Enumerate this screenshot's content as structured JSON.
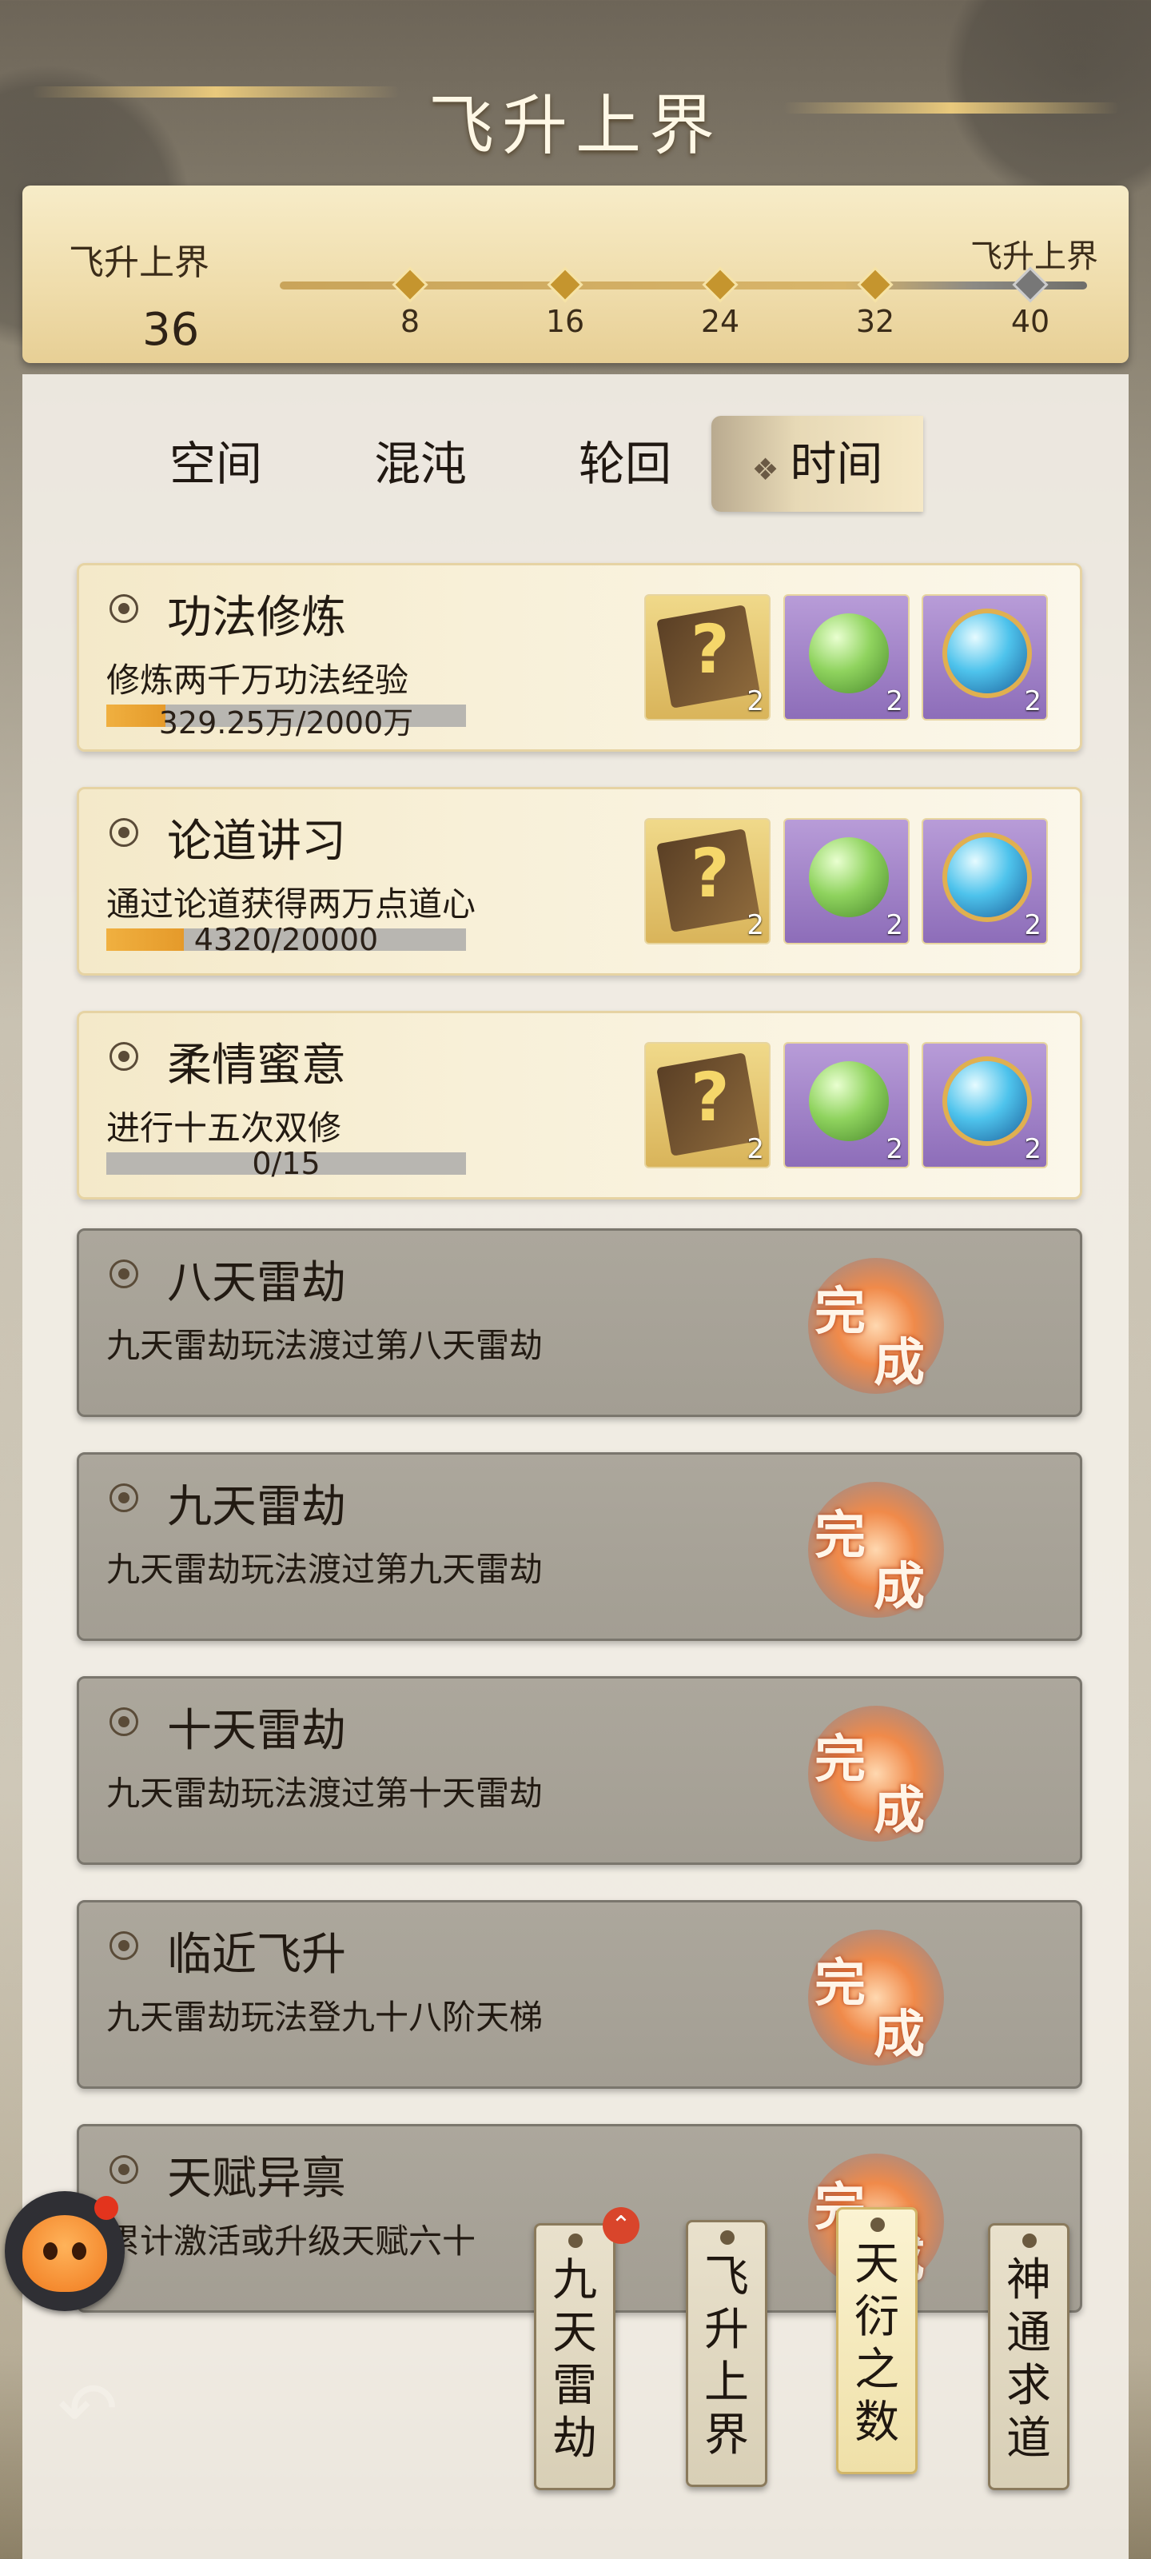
{
  "page": {
    "title": "飞升上界"
  },
  "progress": {
    "left_label": "飞升上界",
    "current": "36",
    "right_label": "飞升上界",
    "ticks": [
      "8",
      "16",
      "24",
      "32",
      "40"
    ]
  },
  "tabs": [
    {
      "label": "空间"
    },
    {
      "label": "混沌"
    },
    {
      "label": "轮回"
    },
    {
      "label": "时间"
    }
  ],
  "tasks": [
    {
      "name": "功法修炼",
      "desc": "修炼两千万功法经验",
      "progress_text": "329.25万/2000万",
      "progress": 0.1646,
      "rewards": [
        "2",
        "2",
        "2"
      ]
    },
    {
      "name": "论道讲习",
      "desc": "通过论道获得两万点道心",
      "progress_text": "4320/20000",
      "progress": 0.216,
      "rewards": [
        "2",
        "2",
        "2"
      ]
    },
    {
      "name": "柔情蜜意",
      "desc": "进行十五次双修",
      "progress_text": "0/15",
      "progress": 0,
      "rewards": [
        "2",
        "2",
        "2"
      ]
    },
    {
      "name": "八天雷劫",
      "desc": "九天雷劫玩法渡过第八天雷劫",
      "status": "完成"
    },
    {
      "name": "九天雷劫",
      "desc": "九天雷劫玩法渡过第九天雷劫",
      "status": "完成"
    },
    {
      "name": "十天雷劫",
      "desc": "九天雷劫玩法渡过第十天雷劫",
      "status": "完成"
    },
    {
      "name": "临近飞升",
      "desc": "九天雷劫玩法登九十八阶天梯",
      "status": "完成"
    },
    {
      "name": "天赋异禀",
      "desc": "累计激活或升级天赋六十",
      "status": "完成"
    }
  ],
  "stamp": {
    "char1": "完",
    "char2": "成"
  },
  "reward_icons": [
    "question-book-icon",
    "green-orb-icon",
    "blue-orb-icon"
  ],
  "bottom_tags": [
    {
      "label": "九天雷劫"
    },
    {
      "label": "飞升上界"
    },
    {
      "label": "天衍之数"
    },
    {
      "label": "神通求道"
    }
  ],
  "badge": {
    "symbol": "⌃"
  },
  "back_icon": "↶"
}
